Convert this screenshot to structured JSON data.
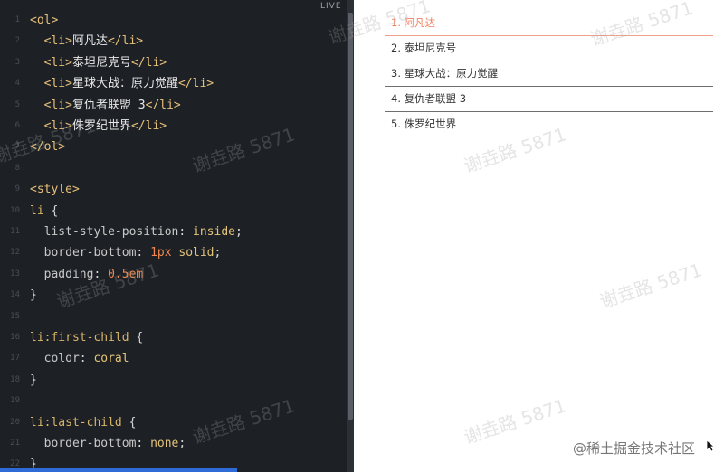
{
  "editor": {
    "lines": [
      {
        "n": "1",
        "parts": [
          {
            "c": "tag",
            "t": "<ol>"
          }
        ]
      },
      {
        "n": "2",
        "parts": [
          {
            "c": "tag",
            "t": "  <li>"
          },
          {
            "c": "txt",
            "t": "阿凡达"
          },
          {
            "c": "tag",
            "t": "</li>"
          }
        ]
      },
      {
        "n": "3",
        "parts": [
          {
            "c": "tag",
            "t": "  <li>"
          },
          {
            "c": "txt",
            "t": "泰坦尼克号"
          },
          {
            "c": "tag",
            "t": "</li>"
          }
        ]
      },
      {
        "n": "4",
        "parts": [
          {
            "c": "tag",
            "t": "  <li>"
          },
          {
            "c": "txt",
            "t": "星球大战：原力觉醒"
          },
          {
            "c": "tag",
            "t": "</li>"
          }
        ]
      },
      {
        "n": "5",
        "parts": [
          {
            "c": "tag",
            "t": "  <li>"
          },
          {
            "c": "txt",
            "t": "复仇者联盟 3"
          },
          {
            "c": "tag",
            "t": "</li>"
          }
        ]
      },
      {
        "n": "6",
        "parts": [
          {
            "c": "tag",
            "t": "  <li>"
          },
          {
            "c": "txt",
            "t": "侏罗纪世界"
          },
          {
            "c": "tag",
            "t": "</li>"
          }
        ]
      },
      {
        "n": "7",
        "parts": [
          {
            "c": "tag",
            "t": "</ol>"
          }
        ]
      },
      {
        "n": "8",
        "parts": []
      },
      {
        "n": "9",
        "parts": [
          {
            "c": "tag",
            "t": "<style>"
          }
        ]
      },
      {
        "n": "10",
        "parts": [
          {
            "c": "sel",
            "t": "li"
          },
          {
            "c": "punc",
            "t": " {"
          }
        ]
      },
      {
        "n": "11",
        "parts": [
          {
            "c": "prop",
            "t": "  list-style-position"
          },
          {
            "c": "punc",
            "t": ": "
          },
          {
            "c": "val",
            "t": "inside"
          },
          {
            "c": "punc",
            "t": ";"
          }
        ]
      },
      {
        "n": "12",
        "parts": [
          {
            "c": "prop",
            "t": "  border-bottom"
          },
          {
            "c": "punc",
            "t": ": "
          },
          {
            "c": "num",
            "t": "1px"
          },
          {
            "c": "val",
            "t": " solid"
          },
          {
            "c": "punc",
            "t": ";"
          }
        ]
      },
      {
        "n": "13",
        "parts": [
          {
            "c": "prop",
            "t": "  padding"
          },
          {
            "c": "punc",
            "t": ": "
          },
          {
            "c": "num",
            "t": "0.5em"
          }
        ]
      },
      {
        "n": "14",
        "parts": [
          {
            "c": "punc",
            "t": "}"
          }
        ]
      },
      {
        "n": "15",
        "parts": []
      },
      {
        "n": "16",
        "parts": [
          {
            "c": "sel",
            "t": "li:first-child"
          },
          {
            "c": "punc",
            "t": " {"
          }
        ]
      },
      {
        "n": "17",
        "parts": [
          {
            "c": "prop",
            "t": "  color"
          },
          {
            "c": "punc",
            "t": ": "
          },
          {
            "c": "val",
            "t": "coral"
          }
        ]
      },
      {
        "n": "18",
        "parts": [
          {
            "c": "punc",
            "t": "}"
          }
        ]
      },
      {
        "n": "19",
        "parts": []
      },
      {
        "n": "20",
        "parts": [
          {
            "c": "sel",
            "t": "li:last-child"
          },
          {
            "c": "punc",
            "t": " {"
          }
        ]
      },
      {
        "n": "21",
        "parts": [
          {
            "c": "prop",
            "t": "  border-bottom"
          },
          {
            "c": "punc",
            "t": ": "
          },
          {
            "c": "val",
            "t": "none"
          },
          {
            "c": "punc",
            "t": ";"
          }
        ]
      },
      {
        "n": "22",
        "parts": [
          {
            "c": "punc",
            "t": "}"
          }
        ]
      }
    ]
  },
  "live_label": "LIVE",
  "preview": {
    "items": [
      {
        "label": "1. 阿凡达"
      },
      {
        "label": "2. 泰坦尼克号"
      },
      {
        "label": "3. 星球大战：原力觉醒"
      },
      {
        "label": "4. 复仇者联盟 3"
      },
      {
        "label": "5. 侏罗纪世界"
      }
    ]
  },
  "watermark": "谢垚路 5871",
  "site_mark": "@稀土掘金技术社区",
  "colors": {
    "coral": "#f08060",
    "accent_bar": "#2e6bd6"
  }
}
